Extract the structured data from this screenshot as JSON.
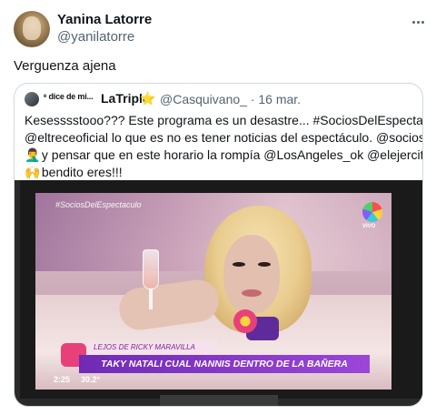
{
  "tweet": {
    "author_name": "Yanina Latorre",
    "author_handle": "@yanilatorre",
    "text": "Verguenza ajena",
    "more_icon": "more-horizontal-icon"
  },
  "quote": {
    "name_prefix": "ᵉ dice de mi...",
    "name": "LaTriple",
    "star_emoji": "⭐",
    "handle_date": "@Casquivano_ · 16 mar.",
    "lines": [
      "Kesesssstooo??? Este programa es un desastre... #SociosDelEspectaculo",
      "@eltreceoficial lo que es no es tener noticias del espectáculo. @socioseltrece",
      "y pensar que en este horario la rompía @LosAngeles_ok @elejercitodelam",
      "bendito eres!!!"
    ],
    "line3_emoji": "🤦‍♂️",
    "line4_emoji": "🙌"
  },
  "media": {
    "show_tag": "#SociosDelEspectaculo",
    "channel_label": "VIVO",
    "lower_third_sub": "LEJOS DE RICKY MARAVILLA",
    "lower_third_main": "TAKY NATALI CUAL NANNIS DENTRO DE LA BAÑERA",
    "time": "2:25",
    "temperature": "30.2°"
  }
}
